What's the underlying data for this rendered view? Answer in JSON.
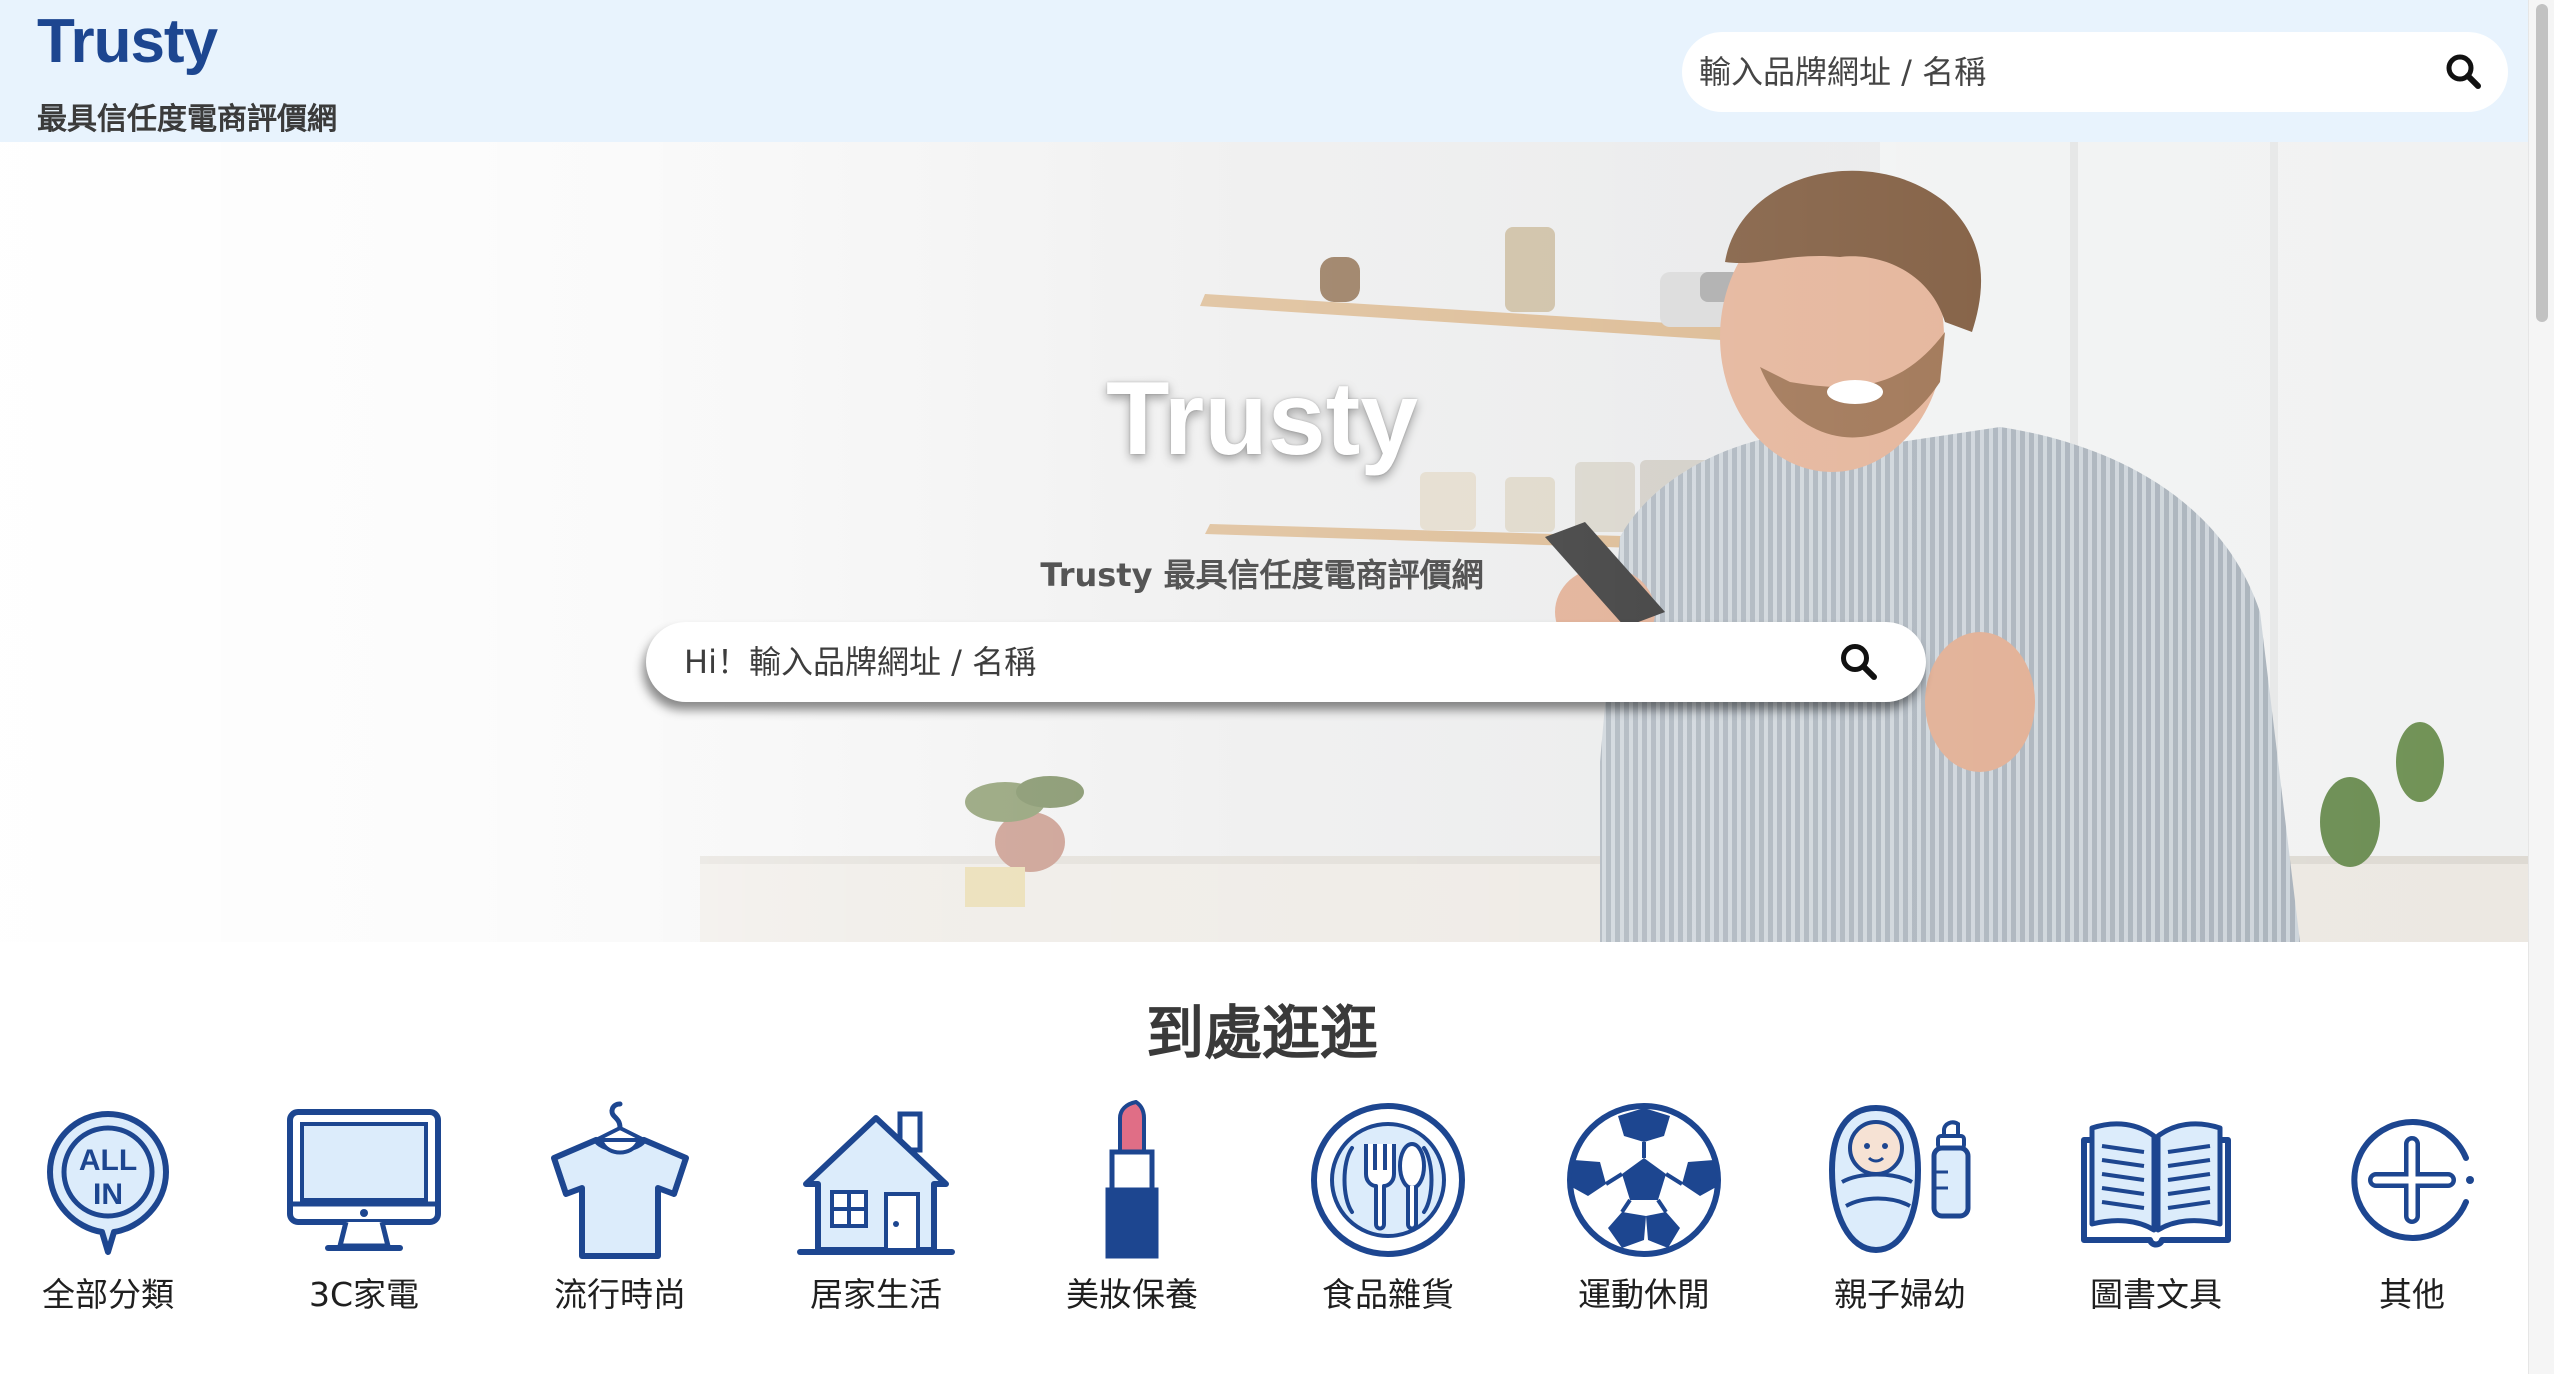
{
  "header": {
    "logo": "Trusty",
    "tagline": "最具信任度電商評價網",
    "search_placeholder": "輸入品牌網址 / 名稱",
    "search_icon": "search-icon"
  },
  "hero": {
    "title": "Trusty",
    "subtitle": "Trusty 最具信任度電商評價網",
    "search_placeholder": "Hi！輸入品牌網址 / 名稱",
    "search_icon": "search-icon"
  },
  "categories_section": {
    "title": "到處逛逛",
    "items": [
      {
        "label": "全部分類",
        "icon": "all-in-icon",
        "icon_text": [
          "ALL",
          "IN"
        ]
      },
      {
        "label": "3C家電",
        "icon": "monitor-icon"
      },
      {
        "label": "流行時尚",
        "icon": "tshirt-icon"
      },
      {
        "label": "居家生活",
        "icon": "house-icon"
      },
      {
        "label": "美妝保養",
        "icon": "lipstick-icon"
      },
      {
        "label": "食品雜貨",
        "icon": "fork-spoon-icon"
      },
      {
        "label": "運動休閒",
        "icon": "soccer-ball-icon"
      },
      {
        "label": "親子婦幼",
        "icon": "baby-bottle-icon"
      },
      {
        "label": "圖書文具",
        "icon": "open-book-icon"
      },
      {
        "label": "其他",
        "icon": "plus-circle-icon"
      }
    ]
  },
  "colors": {
    "brand_blue": "#1d4690",
    "header_bg": "#e8f3fd",
    "icon_fill_light": "#dcecfb"
  }
}
